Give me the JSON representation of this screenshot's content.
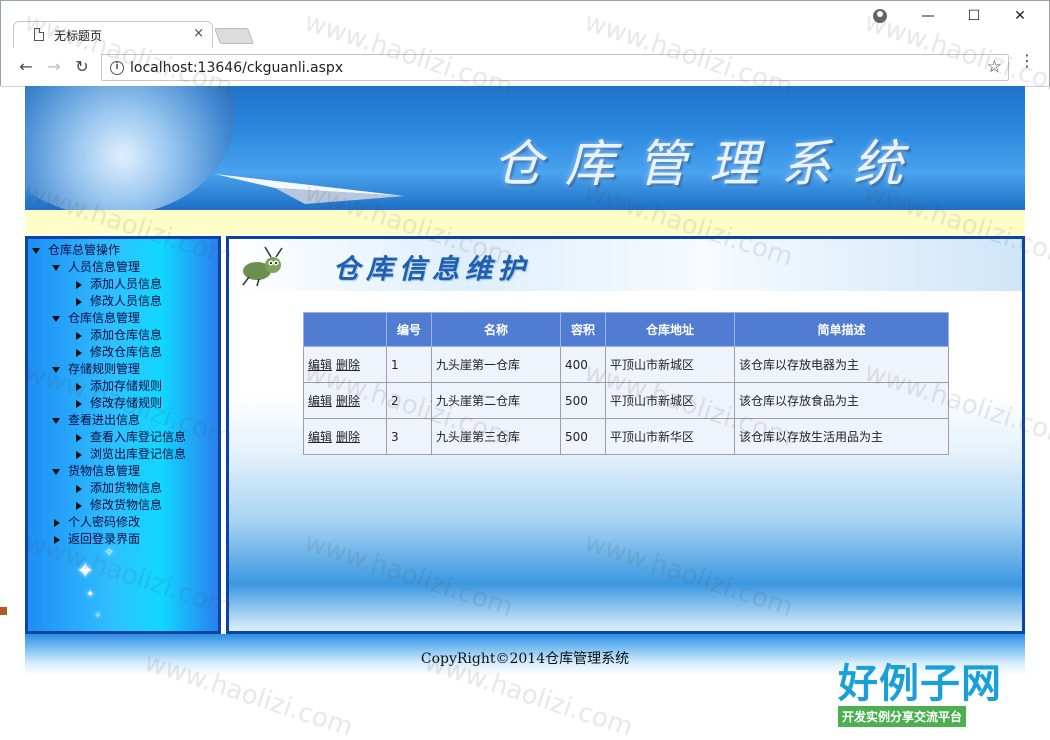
{
  "browser": {
    "tab_title": "无标题页",
    "tab_close": "×",
    "url": "localhost:13646/ckguanli.aspx",
    "back": "←",
    "forward": "→",
    "reload": "↻",
    "star": "☆",
    "menu": "⋮",
    "minimize": "—",
    "maximize": "☐",
    "close": "✕"
  },
  "banner": {
    "title": "仓库管理系统"
  },
  "sidebar": {
    "items": [
      {
        "label": "仓库总管操作",
        "level": 0,
        "expanded": true
      },
      {
        "label": "人员信息管理",
        "level": 1,
        "expanded": true
      },
      {
        "label": "添加人员信息",
        "level": 2
      },
      {
        "label": "修改人员信息",
        "level": 2
      },
      {
        "label": "仓库信息管理",
        "level": 1,
        "expanded": true
      },
      {
        "label": "添加仓库信息",
        "level": 2
      },
      {
        "label": "修改仓库信息",
        "level": 2
      },
      {
        "label": "存储规则管理",
        "level": 1,
        "expanded": true
      },
      {
        "label": "添加存储规则",
        "level": 2
      },
      {
        "label": "修改存储规则",
        "level": 2
      },
      {
        "label": "查看进出信息",
        "level": 1,
        "expanded": true
      },
      {
        "label": "查看入库登记信息",
        "level": 2
      },
      {
        "label": "浏览出库登记信息",
        "level": 2
      },
      {
        "label": "货物信息管理",
        "level": 1,
        "expanded": true
      },
      {
        "label": "添加货物信息",
        "level": 2
      },
      {
        "label": "修改货物信息",
        "level": 2
      },
      {
        "label": "个人密码修改",
        "level": 1
      },
      {
        "label": "返回登录界面",
        "level": 1
      }
    ]
  },
  "main": {
    "title": "仓库信息维护",
    "columns": [
      "",
      "编号",
      "名称",
      "容积",
      "仓库地址",
      "简单描述"
    ],
    "edit_label": "编辑",
    "delete_label": "删除",
    "rows": [
      {
        "id": "1",
        "name": "九头崖第一仓库",
        "volume": "400",
        "address": "平顶山市新城区",
        "desc": "该仓库以存放电器为主"
      },
      {
        "id": "2",
        "name": "九头崖第二仓库",
        "volume": "500",
        "address": "平顶山市新城区",
        "desc": "该仓库以存放食品为主"
      },
      {
        "id": "3",
        "name": "九头崖第三仓库",
        "volume": "500",
        "address": "平顶山市新华区",
        "desc": "该仓库以存放生活用品为主"
      }
    ]
  },
  "footer": {
    "text": "CopyRight©2014仓库管理系统"
  },
  "watermark": {
    "text": "www.haolizi.com",
    "logo_big": "好例子网",
    "logo_small": "开发实例分享交流平台"
  }
}
